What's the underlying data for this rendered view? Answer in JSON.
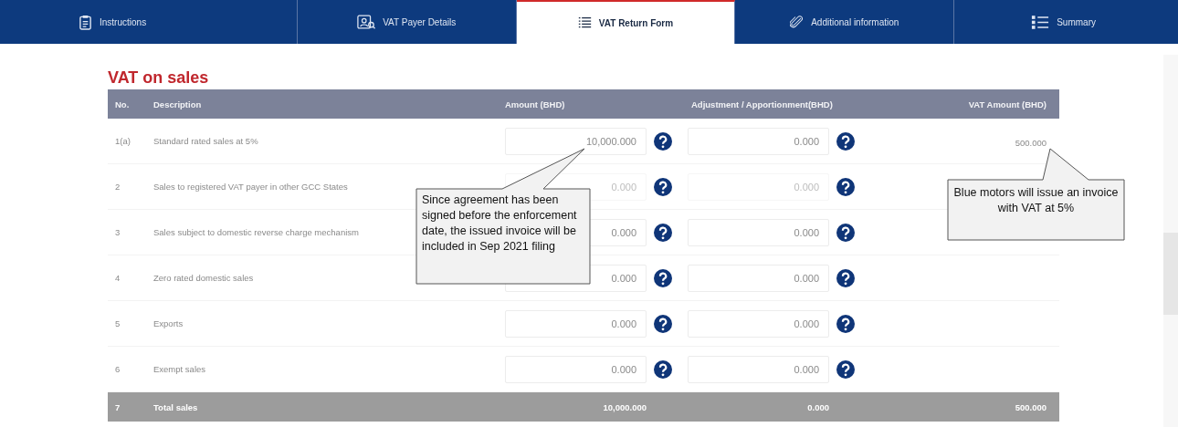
{
  "tabs": [
    {
      "label": "Instructions",
      "selected": false
    },
    {
      "label": "VAT Payer Details",
      "selected": false
    },
    {
      "label": "VAT Return Form",
      "selected": true
    },
    {
      "label": "Additional information",
      "selected": false
    },
    {
      "label": "Summary",
      "selected": false
    }
  ],
  "section_title": "VAT on sales",
  "table": {
    "columns": [
      "No.",
      "Description",
      "Amount (BHD)",
      "Adjustment / Apportionment(BHD)",
      "VAT Amount (BHD)"
    ],
    "rows": [
      {
        "no": "1(a)",
        "description": "Standard rated sales at 5%",
        "amount": {
          "value": "10,000.000",
          "disabled": false
        },
        "adjustment": {
          "value": "0.000",
          "disabled": false
        },
        "vat_amount": "500.000"
      },
      {
        "no": "2",
        "description": "Sales to registered VAT payer in other GCC States",
        "amount": {
          "value": "0.000",
          "disabled": true
        },
        "adjustment": {
          "value": "0.000",
          "disabled": true
        }
      },
      {
        "no": "3",
        "description": "Sales subject to domestic reverse charge mechanism",
        "amount": {
          "value": "0.000",
          "disabled": false
        },
        "adjustment": {
          "value": "0.000",
          "disabled": false
        }
      },
      {
        "no": "4",
        "description": "Zero rated domestic sales",
        "amount": {
          "value": "0.000",
          "disabled": false
        },
        "adjustment": {
          "value": "0.000",
          "disabled": false
        }
      },
      {
        "no": "5",
        "description": "Exports",
        "amount": {
          "value": "0.000",
          "disabled": false
        },
        "adjustment": {
          "value": "0.000",
          "disabled": false
        }
      },
      {
        "no": "6",
        "description": "Exempt sales",
        "amount": {
          "value": "0.000",
          "disabled": false
        },
        "adjustment": {
          "value": "0.000",
          "disabled": false
        }
      }
    ],
    "total": {
      "no": "7",
      "description": "Total sales",
      "amount": "10,000.000",
      "adjustment": "0.000",
      "vat_amount": "500.000"
    }
  },
  "callouts": [
    {
      "text": "Since agreement has been signed before the enforcement date, the issued invoice will be included in Sep 2021 filing"
    },
    {
      "text": "Blue motors will issue an invoice with VAT at 5%"
    }
  ]
}
